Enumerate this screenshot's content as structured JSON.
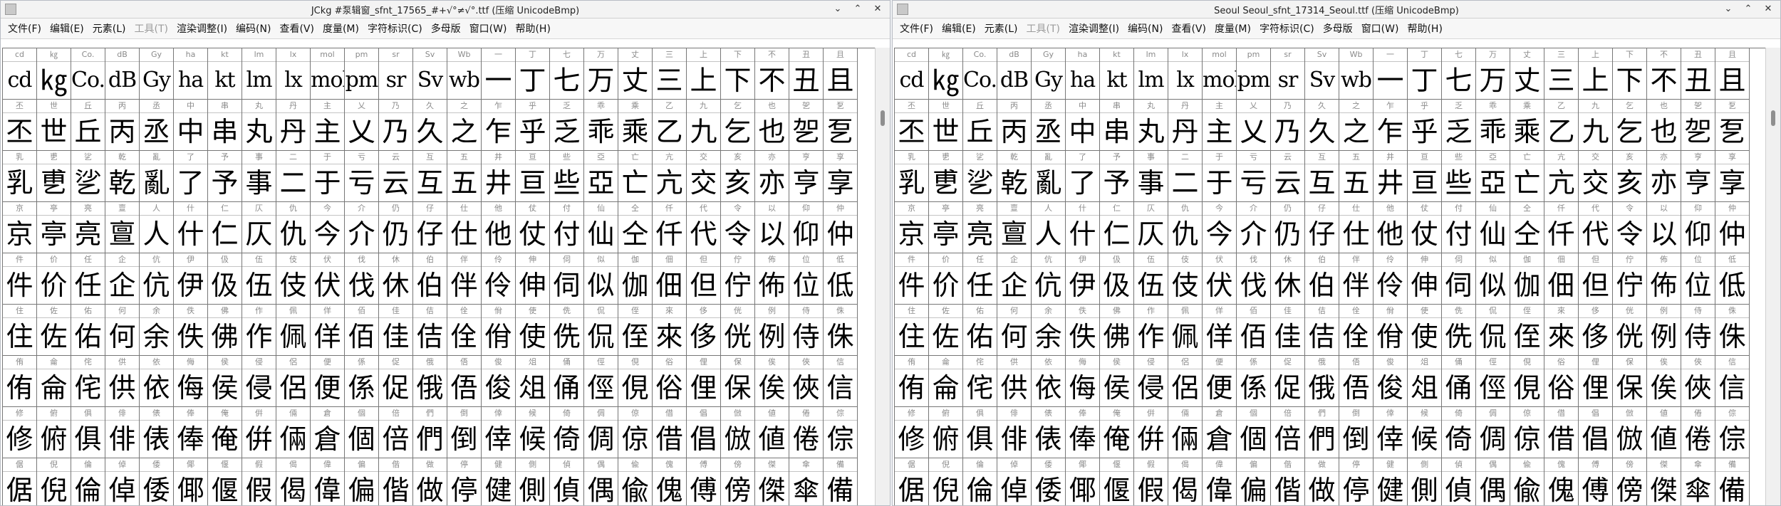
{
  "windows": [
    {
      "title": "JCkg #泵辑窗_sfnt_17565_#+√°≠√°.ttf (压缩 UnicodeBmp)",
      "menu": [
        "文件(F)",
        "编辑(E)",
        "元素(L)",
        "工具(T)",
        "渲染调整(I)",
        "编码(N)",
        "查看(V)",
        "度量(M)",
        "字符标识(C)",
        "多母版",
        "窗口(W)",
        "帮助(H)"
      ]
    },
    {
      "title": "Seoul Seoul_sfnt_17314_Seoul.ttf (压缩 UnicodeBmp)",
      "menu": [
        "文件(F)",
        "编辑(E)",
        "元素(L)",
        "工具(T)",
        "渲染调整(I)",
        "编码(N)",
        "查看(V)",
        "度量(M)",
        "字符标识(C)",
        "多母版",
        "窗口(W)",
        "帮助(H)"
      ]
    }
  ],
  "window_buttons": {
    "minimize": "⌄",
    "maximize": "⌃",
    "close": "✕"
  },
  "disabled_menu_index": 3,
  "grid_labels": [
    [
      "cd",
      "㎏",
      "Co.",
      "dB",
      "Gy",
      "ha",
      "kt",
      "lm",
      "lx",
      "mol",
      "pm",
      "sr",
      "Sv",
      "Wb",
      "一",
      "丁",
      "七",
      "万",
      "丈",
      "三",
      "上",
      "下",
      "不",
      "丑",
      "且"
    ],
    [
      "丕",
      "世",
      "丘",
      "丙",
      "丞",
      "中",
      "串",
      "丸",
      "丹",
      "主",
      "乂",
      "乃",
      "久",
      "之",
      "乍",
      "乎",
      "乏",
      "乖",
      "乘",
      "乙",
      "九",
      "乞",
      "也",
      "乫",
      "乭"
    ],
    [
      "乳",
      "乶",
      "乷",
      "乾",
      "亂",
      "了",
      "予",
      "事",
      "二",
      "于",
      "亏",
      "云",
      "互",
      "五",
      "井",
      "亘",
      "些",
      "亞",
      "亡",
      "亢",
      "交",
      "亥",
      "亦",
      "亨",
      "享"
    ],
    [
      "京",
      "亭",
      "亮",
      "亶",
      "人",
      "什",
      "仁",
      "仄",
      "仇",
      "今",
      "介",
      "仍",
      "仔",
      "仕",
      "他",
      "仗",
      "付",
      "仙",
      "仝",
      "仟",
      "代",
      "令",
      "以",
      "仰",
      "仲"
    ],
    [
      "件",
      "价",
      "任",
      "企",
      "伉",
      "伊",
      "伋",
      "伍",
      "伎",
      "伏",
      "伐",
      "休",
      "伯",
      "伴",
      "伶",
      "伸",
      "伺",
      "似",
      "伽",
      "佃",
      "但",
      "佇",
      "佈",
      "位",
      "低"
    ],
    [
      "住",
      "佐",
      "佑",
      "何",
      "余",
      "佚",
      "佛",
      "作",
      "佩",
      "佯",
      "佰",
      "佳",
      "佶",
      "佺",
      "佾",
      "使",
      "侁",
      "侃",
      "侄",
      "來",
      "侈",
      "侊",
      "例",
      "侍",
      "侏"
    ],
    [
      "侑",
      "侖",
      "侘",
      "供",
      "依",
      "侮",
      "侯",
      "侵",
      "侶",
      "便",
      "係",
      "促",
      "俄",
      "俉",
      "俊",
      "俎",
      "俑",
      "俓",
      "俔",
      "俗",
      "俚",
      "保",
      "俟",
      "俠",
      "信"
    ],
    [
      "修",
      "俯",
      "俱",
      "俳",
      "俵",
      "俸",
      "俺",
      "倂",
      "倆",
      "倉",
      "個",
      "倍",
      "們",
      "倒",
      "倖",
      "候",
      "倚",
      "倜",
      "倞",
      "借",
      "倡",
      "倣",
      "値",
      "倦",
      "倧"
    ],
    [
      "倨",
      "倪",
      "倫",
      "倬",
      "倭",
      "倻",
      "偃",
      "假",
      "偈",
      "偉",
      "偏",
      "偕",
      "做",
      "停",
      "健",
      "側",
      "偵",
      "偶",
      "偸",
      "傀",
      "傅",
      "傍",
      "傑",
      "傘",
      "備"
    ]
  ],
  "grid_glyphs": [
    [
      "cd",
      "㎏",
      "Co.",
      "dB",
      "Gy",
      "ha",
      "kt",
      "lm",
      "lx",
      "mol",
      "pm",
      "sr",
      "Sv",
      "wb",
      "一",
      "丁",
      "七",
      "万",
      "丈",
      "三",
      "上",
      "下",
      "不",
      "丑",
      "且"
    ],
    [
      "丕",
      "世",
      "丘",
      "丙",
      "丞",
      "中",
      "串",
      "丸",
      "丹",
      "主",
      "乂",
      "乃",
      "久",
      "之",
      "乍",
      "乎",
      "乏",
      "乖",
      "乘",
      "乙",
      "九",
      "乞",
      "也",
      "乫",
      "乭"
    ],
    [
      "乳",
      "乶",
      "乷",
      "乾",
      "亂",
      "了",
      "予",
      "事",
      "二",
      "于",
      "亏",
      "云",
      "互",
      "五",
      "井",
      "亘",
      "些",
      "亞",
      "亡",
      "亢",
      "交",
      "亥",
      "亦",
      "亨",
      "享"
    ],
    [
      "京",
      "亭",
      "亮",
      "亶",
      "人",
      "什",
      "仁",
      "仄",
      "仇",
      "今",
      "介",
      "仍",
      "仔",
      "仕",
      "他",
      "仗",
      "付",
      "仙",
      "仝",
      "仟",
      "代",
      "令",
      "以",
      "仰",
      "仲"
    ],
    [
      "件",
      "价",
      "任",
      "企",
      "伉",
      "伊",
      "伋",
      "伍",
      "伎",
      "伏",
      "伐",
      "休",
      "伯",
      "伴",
      "伶",
      "伸",
      "伺",
      "似",
      "伽",
      "佃",
      "但",
      "佇",
      "佈",
      "位",
      "低"
    ],
    [
      "住",
      "佐",
      "佑",
      "何",
      "余",
      "佚",
      "佛",
      "作",
      "佩",
      "佯",
      "佰",
      "佳",
      "佶",
      "佺",
      "佾",
      "使",
      "侁",
      "侃",
      "侄",
      "來",
      "侈",
      "侊",
      "例",
      "侍",
      "侏"
    ],
    [
      "侑",
      "侖",
      "侘",
      "供",
      "依",
      "侮",
      "侯",
      "侵",
      "侶",
      "便",
      "係",
      "促",
      "俄",
      "俉",
      "俊",
      "俎",
      "俑",
      "俓",
      "俔",
      "俗",
      "俚",
      "保",
      "俟",
      "俠",
      "信"
    ],
    [
      "修",
      "俯",
      "俱",
      "俳",
      "俵",
      "俸",
      "俺",
      "倂",
      "倆",
      "倉",
      "個",
      "倍",
      "們",
      "倒",
      "倖",
      "候",
      "倚",
      "倜",
      "倞",
      "借",
      "倡",
      "倣",
      "値",
      "倦",
      "倧"
    ],
    [
      "倨",
      "倪",
      "倫",
      "倬",
      "倭",
      "倻",
      "偃",
      "假",
      "偈",
      "偉",
      "偏",
      "偕",
      "做",
      "停",
      "健",
      "側",
      "偵",
      "偶",
      "偸",
      "傀",
      "傅",
      "傍",
      "傑",
      "傘",
      "備"
    ]
  ]
}
